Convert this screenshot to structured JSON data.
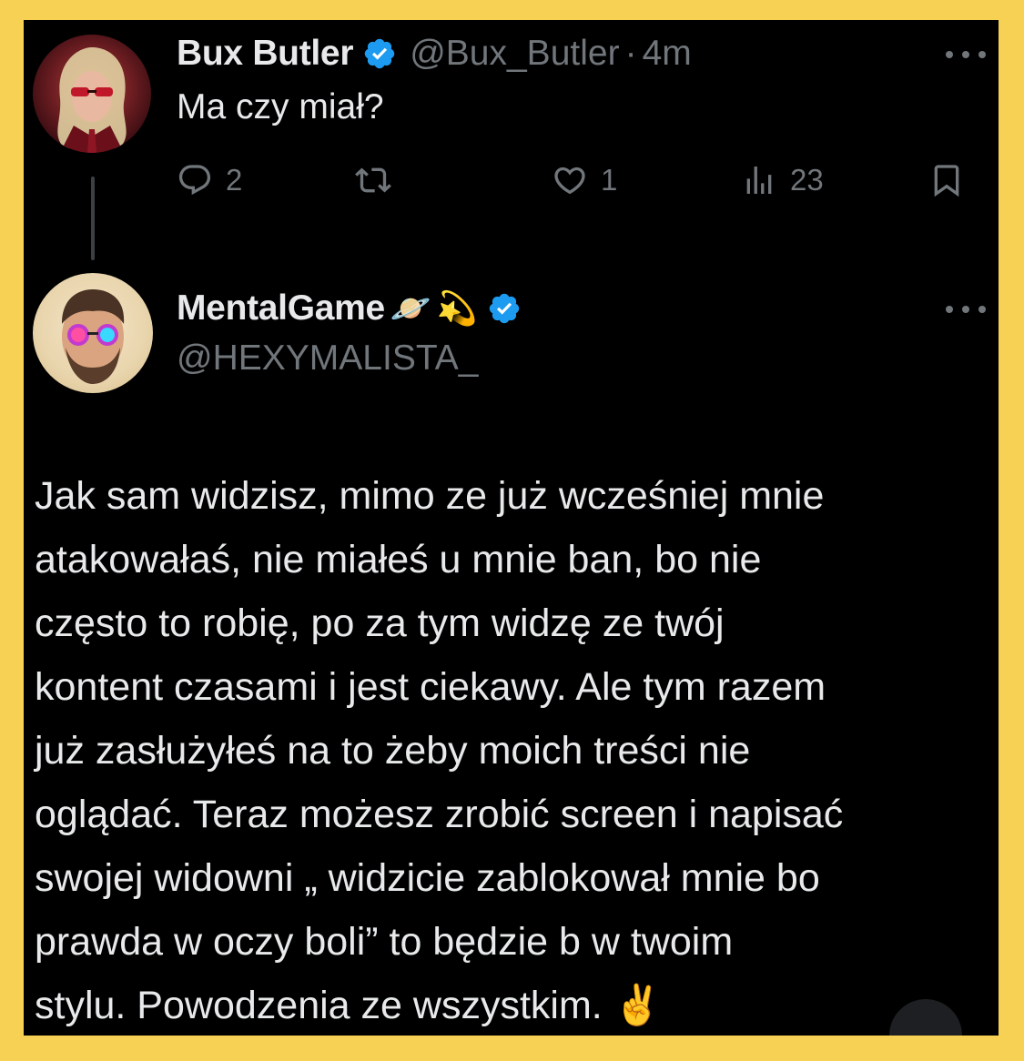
{
  "tweet": {
    "author_name": "Bux Butler",
    "author_handle": "@Bux_Butler",
    "separator": "·",
    "time": "4m",
    "text": "Ma czy miał?",
    "counts": {
      "replies": "2",
      "retweets": "",
      "likes": "1",
      "views": "23"
    }
  },
  "reply": {
    "author_name": "MentalGame",
    "author_emojis": [
      "🪐",
      "💫"
    ],
    "author_handle": "@HEXYMALISTA_",
    "text_lines": [
      "Jak sam widzisz, mimo ze już wcześniej mnie",
      "atakowałaś, nie miałeś u mnie ban, bo nie",
      "często to robię, po za tym widzę ze twój",
      "kontent czasami i jest ciekawy. Ale tym razem",
      "już zasłużyłeś na to żeby moich treści nie",
      "oglądać. Teraz możesz zrobić screen i napisać",
      "swojej widowni „ widzicie zablokował mnie bo",
      "prawda w oczy boli” to będzie b w twoim",
      "stylu. Powodzenia ze wszystkim. ✌️"
    ]
  },
  "colors": {
    "frame_border": "#f7d154",
    "background": "#000000",
    "primary_text": "#e7e9ea",
    "secondary_text": "#71767b",
    "verified": "#1d9bf0"
  },
  "icons": {
    "verified": "verified-badge-icon",
    "more": "more-dots-icon",
    "reply": "reply-bubble-icon",
    "retweet": "retweet-icon",
    "like": "heart-icon",
    "views": "views-bars-icon",
    "bookmark": "bookmark-icon"
  }
}
